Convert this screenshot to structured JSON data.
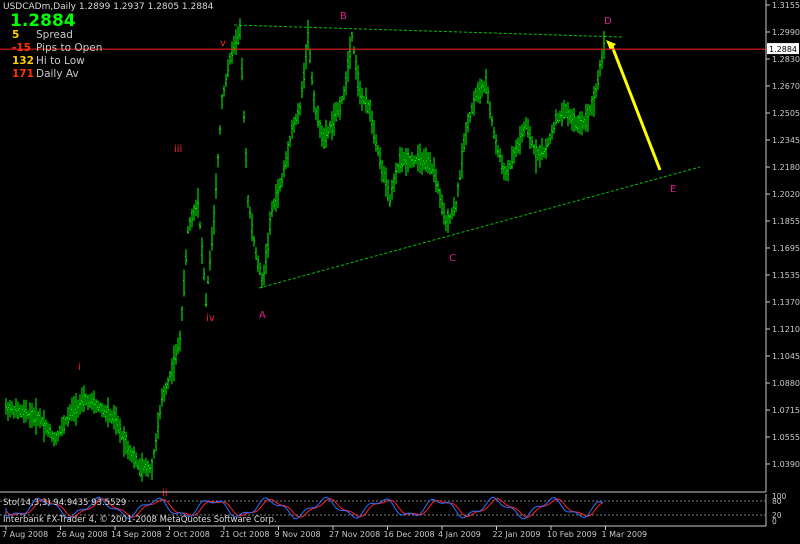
{
  "header": {
    "symbol_line": "USDCADm,Daily  1.2899 1.2937 1.2805 1.2884",
    "big_price": "1.2884"
  },
  "info_panel": [
    {
      "value": "5",
      "label": "Spread",
      "color": "#ffd000"
    },
    {
      "value": "-15",
      "label": "Pips to Open",
      "color": "#ff3300"
    },
    {
      "value": "132",
      "label": "Hi to Low",
      "color": "#ffd000"
    },
    {
      "value": "171",
      "label": "Daily Av",
      "color": "#ff3300"
    }
  ],
  "price_axis": {
    "ticks": [
      "1.3155",
      "1.2990",
      "1.2830",
      "1.2670",
      "1.2505",
      "1.2345",
      "1.2180",
      "1.2020",
      "1.1855",
      "1.1695",
      "1.1535",
      "1.1370",
      "1.1210",
      "1.1045",
      "1.0880",
      "1.0715",
      "1.0555",
      "1.0390"
    ],
    "current_price_label": "1.2884",
    "indicator_ticks": [
      "100",
      "80",
      "20",
      "0"
    ]
  },
  "time_axis": {
    "ticks": [
      "7 Aug 2008",
      "26 Aug 2008",
      "14 Sep 2008",
      "2 Oct 2008",
      "21 Oct 2008",
      "9 Nov 2008",
      "27 Nov 2008",
      "16 Dec 2008",
      "4 Jan 2009",
      "22 Jan 2009",
      "10 Feb 2009",
      "1 Mar 2009"
    ]
  },
  "wave_labels": [
    {
      "text": "i",
      "color": "#ff2020"
    },
    {
      "text": "ii",
      "color": "#ff2020"
    },
    {
      "text": "iii",
      "color": "#ff2020"
    },
    {
      "text": "iv",
      "color": "#ff2020"
    },
    {
      "text": "v",
      "color": "#ff2020"
    },
    {
      "text": "A",
      "color": "#e0208f"
    },
    {
      "text": "B",
      "color": "#e0208f"
    },
    {
      "text": "C",
      "color": "#e0208f"
    },
    {
      "text": "D",
      "color": "#e0208f"
    },
    {
      "text": "E",
      "color": "#e0208f"
    }
  ],
  "indicator": {
    "title": "Sto(14,3,3) 94.9435 93.5529"
  },
  "copyright": "Interbank FX-Trader 4, © 2001-2008 MetaQuotes Software Corp.",
  "colors": {
    "background": "#000000",
    "candle": "#00ff00",
    "grid_axis": "#c8c8c8",
    "current_price_line": "#ff2020",
    "trendline": "#00c000",
    "projection_arrow": "#ffff00",
    "stoch_main": "#2f6fff",
    "stoch_signal": "#ff2020"
  }
}
